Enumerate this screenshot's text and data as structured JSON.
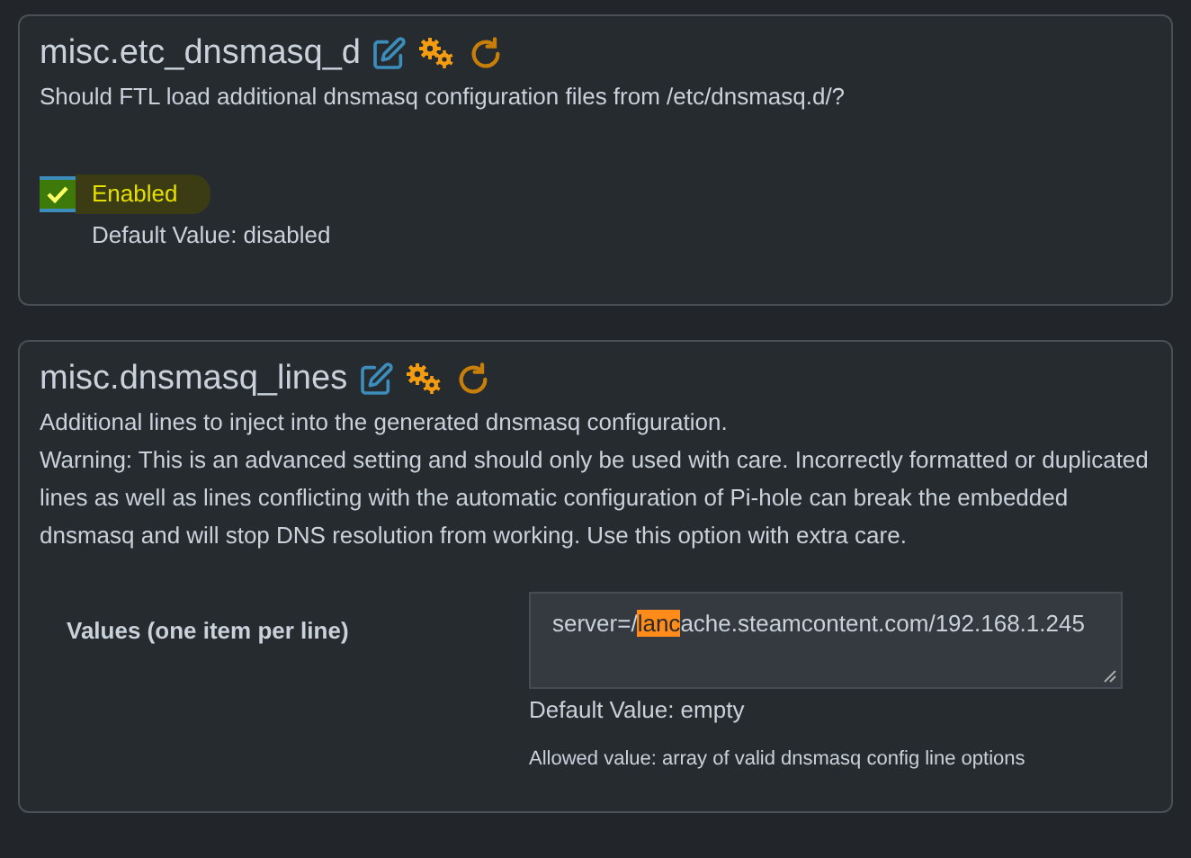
{
  "settings": [
    {
      "kind": "checkbox",
      "name": "misc.etc_dnsmasq_d",
      "description": [
        "Should FTL load additional dnsmasq configuration files from /etc/dnsmasq.d/?"
      ],
      "checkbox": {
        "label": "Enabled",
        "checked": true,
        "highlighted": true
      },
      "default_value": "Default Value: disabled"
    },
    {
      "kind": "textarea",
      "name": "misc.dnsmasq_lines",
      "description": [
        "Additional lines to inject into the generated dnsmasq configuration.",
        "Warning: This is an advanced setting and should only be used with care. Incorrectly formatted or duplicated lines as well as lines conflicting with the automatic configuration of Pi-hole can break the embedded dnsmasq and will stop DNS resolution from working. Use this option with extra care."
      ],
      "field_label": "Values (one item per line)",
      "value_parts": [
        {
          "text": "server=/",
          "highlighted": false
        },
        {
          "text": "lanc",
          "highlighted": true
        },
        {
          "text": "ache.steamcontent.com/192.168.1.245",
          "highlighted": false
        }
      ],
      "default_value": "Default Value: empty",
      "allowed_value": "Allowed value: array of valid dnsmasq config line options"
    }
  ]
}
